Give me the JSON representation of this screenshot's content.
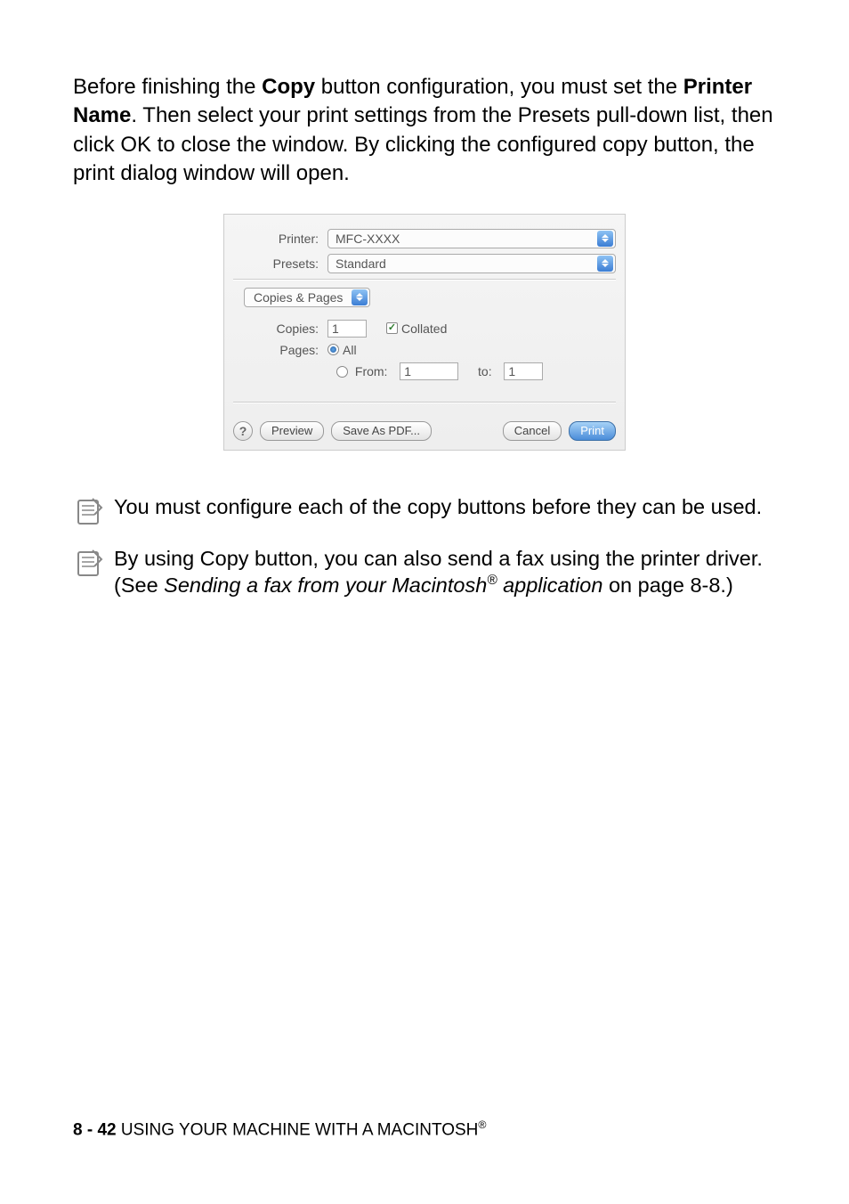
{
  "paragraph": {
    "p1a": "Before finishing the ",
    "p1b": "Copy",
    "p1c": " button configuration, you must set the ",
    "p1d": "Printer Name",
    "p1e": ". Then select your print settings from the Presets pull-down list, then click OK to close the window. By clicking the configured copy button, the print dialog window will open."
  },
  "dialog": {
    "printer_label": "Printer:",
    "printer_value": "MFC-XXXX",
    "presets_label": "Presets:",
    "presets_value": "Standard",
    "section_value": "Copies & Pages",
    "copies_label": "Copies:",
    "copies_value": "1",
    "collated_label": "Collated",
    "pages_label": "Pages:",
    "pages_all": "All",
    "pages_from_label": "From:",
    "pages_from_value": "1",
    "pages_to_label": "to:",
    "pages_to_value": "1",
    "help_label": "?",
    "preview_label": "Preview",
    "save_pdf_label": "Save As PDF...",
    "cancel_label": "Cancel",
    "print_label": "Print"
  },
  "note1": "You must configure each of the copy buttons before they can be used.",
  "note2": {
    "a": "By using Copy button, you can also send a fax using the printer driver. (See ",
    "b": "Sending a fax from your Macintosh",
    "c": " application",
    "d": " on page 8-8.)"
  },
  "footer": {
    "page": "8 - 42",
    "title": "   USING YOUR MACHINE WITH A MACINTOSH",
    "reg": "®"
  }
}
